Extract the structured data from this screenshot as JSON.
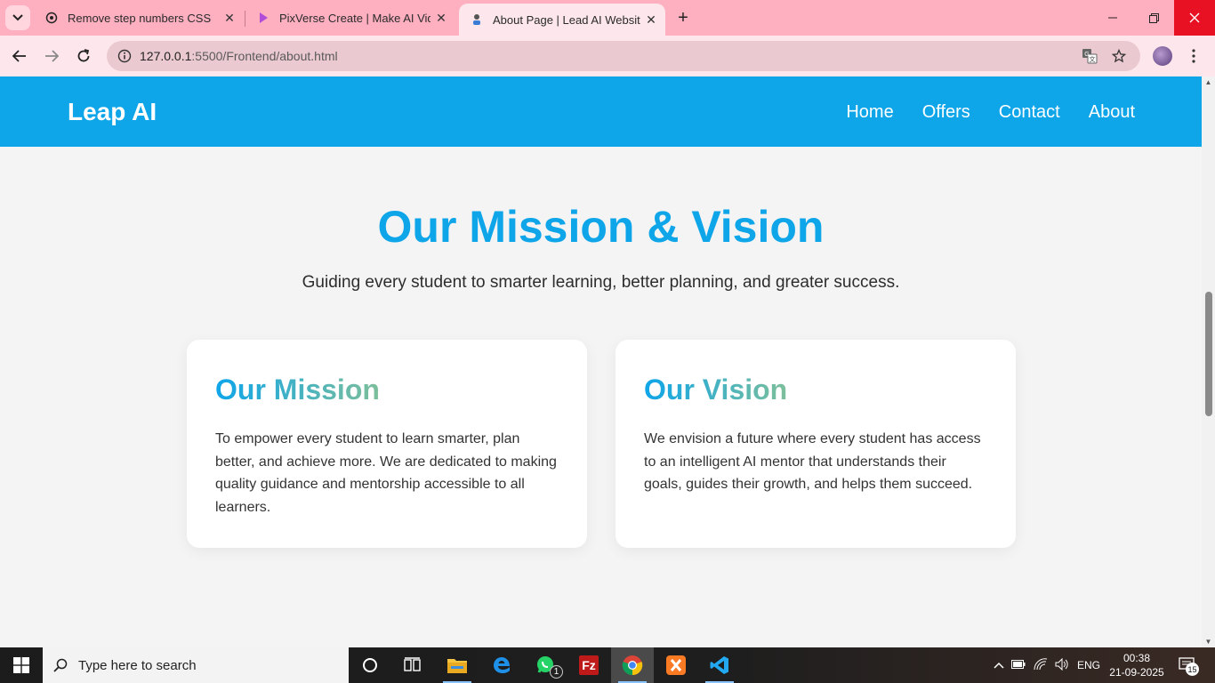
{
  "browser": {
    "tabs": [
      {
        "title": "Remove step numbers CSS",
        "active": false
      },
      {
        "title": "PixVerse Create | Make AI Video",
        "active": false
      },
      {
        "title": "About Page | Lead AI Website",
        "active": true
      }
    ],
    "url_host": "127.0.0.1",
    "url_path": ":5500/Frontend/about.html"
  },
  "site": {
    "logo": "Leap AI",
    "nav": [
      {
        "label": "Home"
      },
      {
        "label": "Offers"
      },
      {
        "label": "Contact"
      },
      {
        "label": "About"
      }
    ],
    "hero": {
      "title": "Our Mission & Vision",
      "subtitle": "Guiding every student to smarter learning, better planning, and greater success."
    },
    "cards": [
      {
        "title": "Our Mission",
        "body": "To empower every student to learn smarter, plan better, and achieve more. We are dedicated to making quality guidance and mentorship accessible to all learners."
      },
      {
        "title": "Our Vision",
        "body": "We envision a future where every student has access to an intelligent AI mentor that understands their goals, guides their growth, and helps them succeed."
      }
    ],
    "colors": {
      "brand": "#0ea5e9",
      "gradient_end": "#7dbf9b",
      "page_bg": "#f4f4f4"
    }
  },
  "taskbar": {
    "search_placeholder": "Type here to search",
    "whatsapp_badge": "1",
    "language": "ENG",
    "time": "00:38",
    "date": "21-09-2025",
    "notification_count": "15"
  }
}
